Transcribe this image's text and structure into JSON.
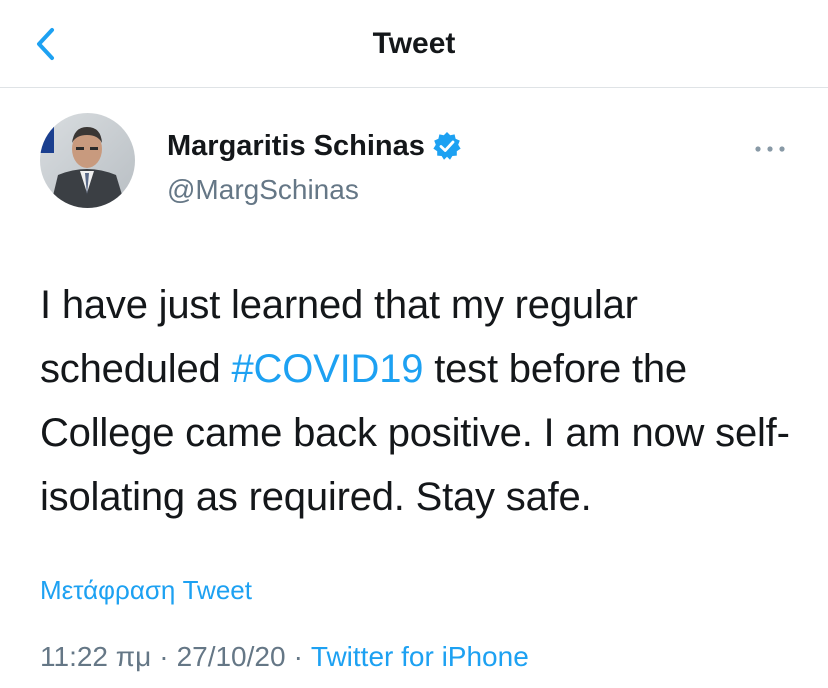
{
  "header": {
    "title": "Tweet",
    "back_icon": "chevron-left-icon"
  },
  "author": {
    "name": "Margaritis Schinas",
    "handle": "@MargSchinas",
    "verified": true,
    "verified_icon": "verified-badge-icon"
  },
  "menu": {
    "icon": "more-options-icon"
  },
  "tweet": {
    "text_parts": [
      "I have just learned that my regular scheduled ",
      "#COVID19",
      " test before the College came back positive. I am now self-isolating as required. Stay safe."
    ],
    "hashtag": "#COVID19",
    "translate_label": "Μετάφραση Tweet"
  },
  "meta": {
    "time": "11:22 πμ",
    "separator": "·",
    "date": "27/10/20",
    "source": "Twitter for iPhone"
  },
  "colors": {
    "accent": "#1da1f2",
    "text": "#14171a",
    "secondary": "#657786"
  }
}
